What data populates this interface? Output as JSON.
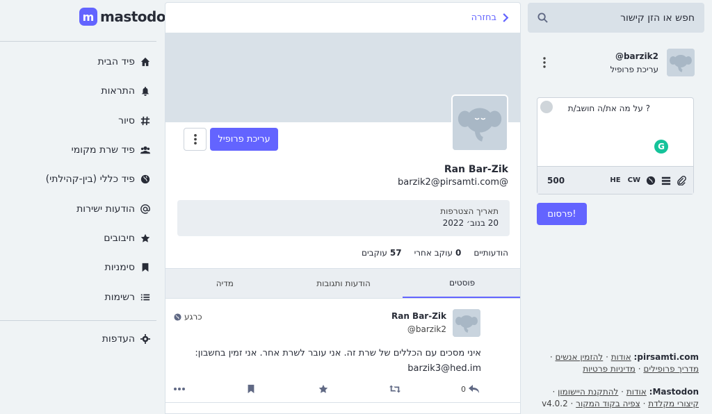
{
  "logo": {
    "wordmark": "mastodon"
  },
  "nav": {
    "items": [
      {
        "label": "פיד הבית",
        "icon": "home-icon"
      },
      {
        "label": "התראות",
        "icon": "bell-icon"
      },
      {
        "label": "סיור",
        "icon": "hashtag-icon"
      },
      {
        "label": "פיד שרת מקומי",
        "icon": "users-icon"
      },
      {
        "label": "פיד כללי (בין-קהילתי)",
        "icon": "globe-icon"
      },
      {
        "label": "הודעות ישירות",
        "icon": "at-icon"
      },
      {
        "label": "חיבובים",
        "icon": "star-icon"
      },
      {
        "label": "סימניות",
        "icon": "bookmark-icon"
      },
      {
        "label": "רשימות",
        "icon": "list-icon"
      }
    ],
    "settings_label": "העדפות"
  },
  "column": {
    "back_label": "בחזרה",
    "edit_profile_label": "עריכת פרופיל",
    "display_name": "Ran Bar-Zik",
    "handle": "barzik2@pirsamti.com@",
    "joined_label": "תאריך הצטרפות",
    "joined_value": "20 בנוב׳ 2022",
    "counts": {
      "posts_label": "הודעותיים",
      "following_value": "0",
      "following_label": "עוקב אחרי",
      "followers_value": "57",
      "followers_label": "עוקבים"
    },
    "tabs": [
      "פוסטים",
      "הודעות ותגובות",
      "מדיה"
    ]
  },
  "post": {
    "display_name": "Ran Bar-Zik",
    "handle": "barzik2@",
    "time": "כרגע",
    "body": "איני מסכים עם הכללים של שרת זה. אני עובר לשרת אחר. אני זמין בחשבון: barzik3@hed.im",
    "reply_count": "0"
  },
  "compose": {
    "search_placeholder": "חפש או הזן קישור",
    "account_handle": "barzik2@",
    "account_edit": "עריכת פרופיל",
    "placeholder": "? על מה את/ה חושב/ת",
    "char_count": "500",
    "lang_label": "HE",
    "cw_label": "CW",
    "grammarly": "G",
    "publish_label": "פרסום!"
  },
  "footer": {
    "server_label": "pirsamti.com:",
    "server_links": [
      "אודות",
      "להזמין אנשים",
      "מדריך פרופילים",
      "מדיניות פרטיות"
    ],
    "mastodon_label": "Mastodon:",
    "mastodon_links": [
      "אודות",
      "להתקנת היישומון",
      "קיצורי מקלדת",
      "צפיה בקוד המקור"
    ],
    "version": "v4.0.2"
  },
  "colors": {
    "accent": "#6364ff",
    "background": "#eff3f5"
  }
}
